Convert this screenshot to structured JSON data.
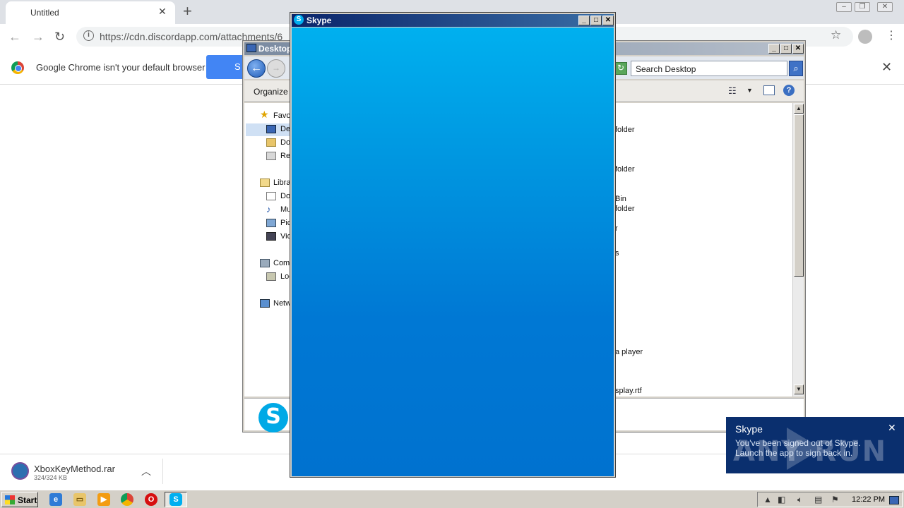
{
  "chrome": {
    "tab_title": "Untitled",
    "url": "https://cdn.discordapp.com/attachments/6",
    "infobar_message": "Google Chrome isn't your default browser",
    "infobar_button": "S"
  },
  "downloads": {
    "file_name": "XboxKeyMethod.rar",
    "file_size": "324/324 KB"
  },
  "explorer": {
    "title": "Desktop",
    "search_placeholder": "Search Desktop",
    "organize_label": "Organize",
    "nav": {
      "favorites": "Favo",
      "desktop": "De",
      "downloads": "Do",
      "recent": "Re",
      "libraries": "Libra",
      "documents": "Do",
      "music": "Mu",
      "pictures": "Pic",
      "videos": "Vid",
      "computer": "Comp",
      "local_disk": "Loc",
      "network": "Netw"
    },
    "file_fragments": [
      "folder",
      "folder",
      "Bin",
      "folder",
      "r",
      "s",
      "a player",
      "splay.rtf"
    ]
  },
  "skype_window": {
    "title": "Skype"
  },
  "toast": {
    "title": "Skype",
    "message": "You've been signed out of Skype. Launch the app to sign back in.",
    "watermark": "ANY RUN"
  },
  "taskbar": {
    "start_label": "Start",
    "clock": "12:22 PM"
  }
}
